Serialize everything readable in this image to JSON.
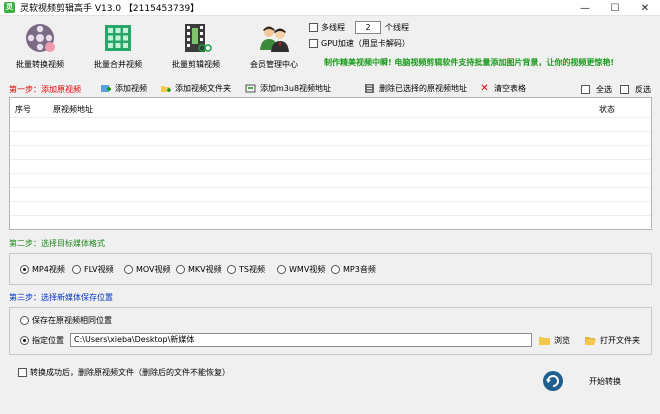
{
  "window": {
    "title": "灵软视频剪辑高手 V13.0 【2115453739】",
    "controls": {
      "minimize": "—",
      "maximize": "☐",
      "close": "✕"
    }
  },
  "toolbar": {
    "batch_convert": "批量转换视频",
    "batch_merge": "批量合并视频",
    "batch_cut": "批量剪辑视频",
    "member_center": "会员管理中心"
  },
  "options": {
    "multithread_label": "多线程",
    "thread_count": "2",
    "thread_unit": "个线程",
    "gpu_label": "GPU加速（用显卡解码）"
  },
  "promo_text": "制作精美视频中瞬! 电脑视频剪辑软件支持批量添加图片背景，让你的视频更惊艳!",
  "step1": {
    "label": "第一步：添加原视频",
    "add_video": "添加视频",
    "add_folder": "添加视频文件夹",
    "add_m3u8": "添加m3u8视频地址",
    "delete_selected": "删除已选择的原视频地址",
    "clear_table": "清空表格",
    "select_all": "全选",
    "invert_select": "反选"
  },
  "table": {
    "columns": {
      "index": "序号",
      "path": "原视频地址",
      "status": "状态"
    },
    "rows": []
  },
  "step2": {
    "label": "第二步：选择目标媒体格式",
    "formats": [
      "MP4视频",
      "FLV视频",
      "MOV视频",
      "MKV视频",
      "TS视频",
      "WMV视频",
      "MP3音频"
    ],
    "selected": "MP4视频"
  },
  "step3": {
    "label": "第三步：选择新媒体保存位置",
    "same_location": "保存在原视频相同位置",
    "custom_location": "指定位置",
    "path_value": "C:\\Users\\xieba\\Desktop\\新媒体",
    "browse": "浏览",
    "open_folder": "打开文件夹"
  },
  "footer": {
    "delete_after": "转换成功后，删除原视频文件（删除后的文件不能恢复）",
    "start": "开始转换"
  },
  "colors": {
    "step1": "#e00000",
    "step2": "#1a8a1a",
    "step3": "#0033cc",
    "promo": "#1a9a1a"
  }
}
